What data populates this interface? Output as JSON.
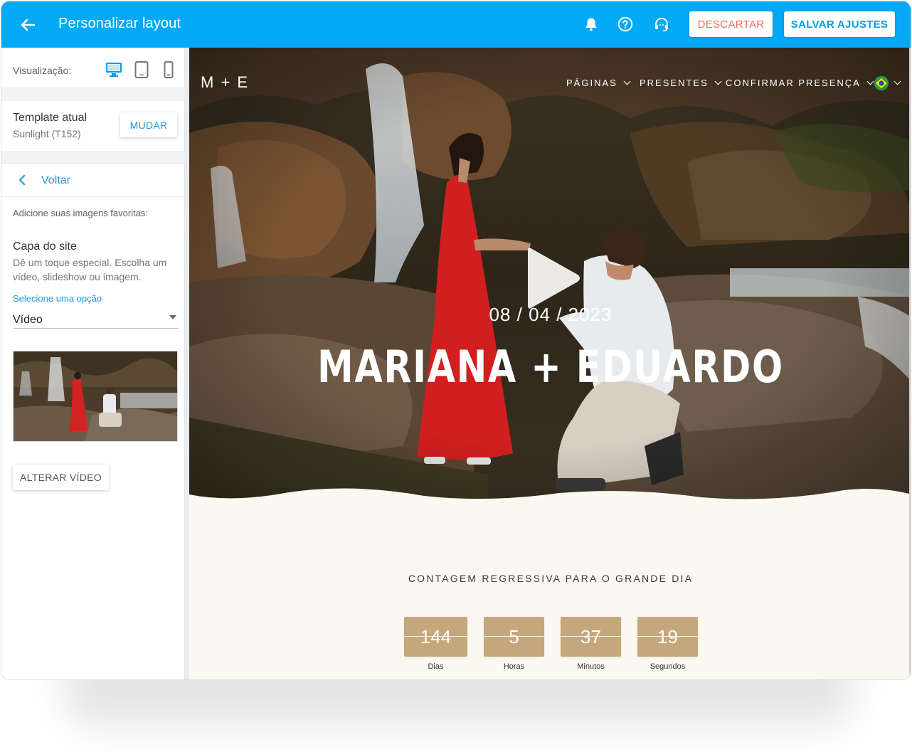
{
  "header": {
    "title": "Personalizar layout",
    "discard_label": "DESCARTAR",
    "save_label": "SALVAR AJUSTES",
    "accent_color": "#03a9f4"
  },
  "sidebar": {
    "visualization_label": "Visualização:",
    "devices": [
      "desktop-icon",
      "tablet-icon",
      "mobile-icon"
    ],
    "template": {
      "title": "Template atual",
      "name": "Sunlight (T152)",
      "change_label": "MUDAR"
    },
    "back_label": "Voltar",
    "add_images_label": "Adicione suas imagens favoritas:",
    "cover": {
      "title": "Capa do site",
      "description": "Dê um toque especial. Escolha um vídeo, slideshow ou imagem.",
      "select_label": "Selecione uma opção",
      "select_value": "Vídeo",
      "change_video_label": "ALTERAR VÍDEO"
    }
  },
  "preview": {
    "logo": "M + E",
    "nav": [
      {
        "label": "PÁGINAS"
      },
      {
        "label": "PRESENTES"
      },
      {
        "label": "CONFIRMAR PRESENÇA"
      }
    ],
    "hero": {
      "date": "08 / 04 / 2023",
      "names": "MARIANA + EDUARDO"
    },
    "countdown": {
      "title": "CONTAGEM REGRESSIVA PARA O GRANDE DIA",
      "units": [
        {
          "value": "144",
          "label": "Dias"
        },
        {
          "value": "5",
          "label": "Horas"
        },
        {
          "value": "37",
          "label": "Minutos"
        },
        {
          "value": "19",
          "label": "Segundos"
        }
      ],
      "box_color": "#c4a77a"
    }
  }
}
